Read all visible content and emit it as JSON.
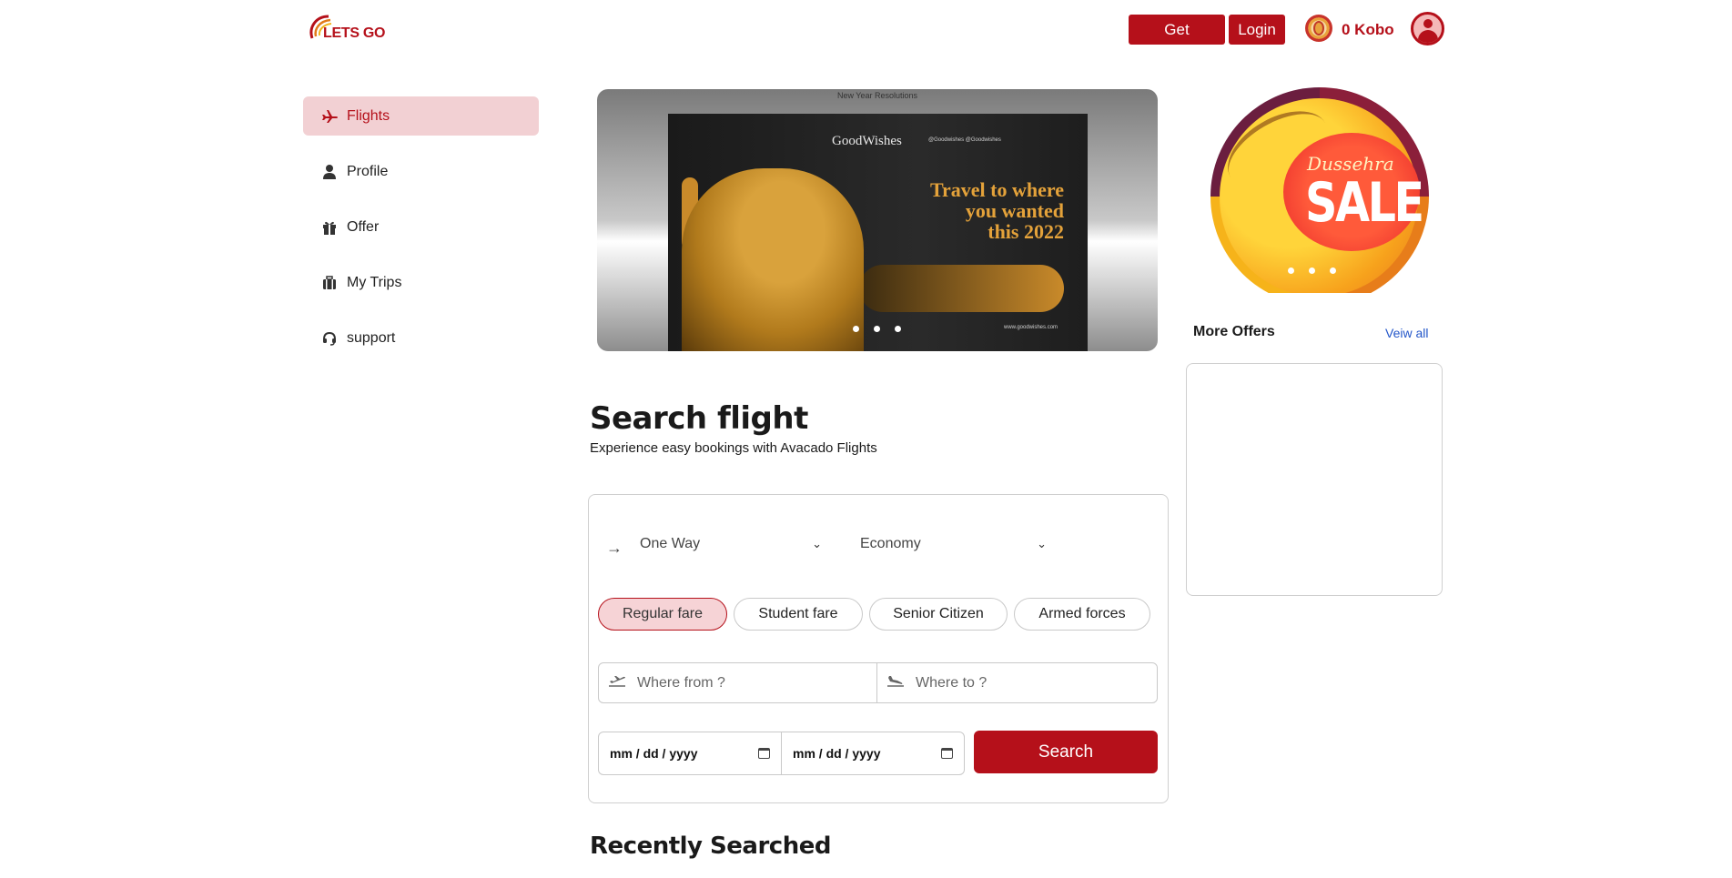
{
  "header": {
    "logo_text": "LETS GO",
    "get_started_label": "Get Started",
    "login_label": "Login",
    "wallet_balance": "0 Kobo"
  },
  "sidebar": {
    "items": [
      {
        "label": "Flights",
        "icon": "plane-icon",
        "active": true
      },
      {
        "label": "Profile",
        "icon": "user-icon",
        "active": false
      },
      {
        "label": "Offer",
        "icon": "gift-icon",
        "active": false
      },
      {
        "label": "My Trips",
        "icon": "suitcase-icon",
        "active": false
      },
      {
        "label": "support",
        "icon": "headset-icon",
        "active": false
      }
    ]
  },
  "banner": {
    "caption": "New Year Resolutions",
    "brand": "GoodWishes",
    "social": "@Goodwishes  @Goodwishes",
    "tagline_1": "Travel to where",
    "tagline_2": "you wanted",
    "tagline_3": "this 2022",
    "url": "www.goodwishes.com",
    "slide_count": 3
  },
  "promo": {
    "script_text": "Dussehra",
    "sale_text": "SALE",
    "slide_count": 3
  },
  "offers": {
    "title": "More Offers",
    "view_all_label": "Veiw all"
  },
  "search": {
    "title": "Search flight",
    "subtitle": "Experience easy bookings with Avacado Flights",
    "trip_type": "One Way",
    "cabin_class": "Economy",
    "fares": [
      "Regular fare",
      "Student fare",
      "Senior Citizen",
      "Armed forces"
    ],
    "active_fare": "Regular fare",
    "from_placeholder": "Where from ?",
    "to_placeholder": "Where to ?",
    "date_placeholder": "mm / dd / yyyy",
    "search_label": "Search"
  },
  "recent": {
    "title": "Recently Searched"
  },
  "colors": {
    "brand": "#b5101a",
    "active_bg": "#f2d0d3",
    "link": "#2356c9"
  }
}
